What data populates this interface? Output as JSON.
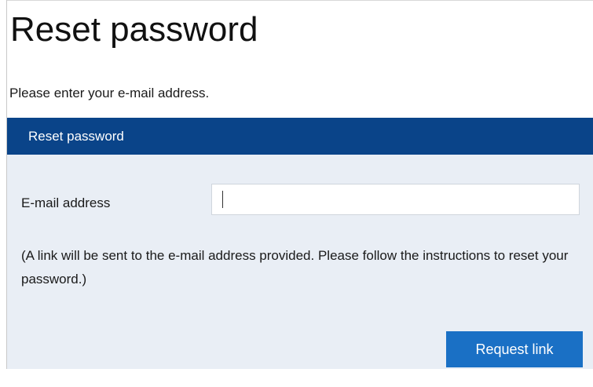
{
  "page": {
    "title": "Reset password",
    "intro": "Please enter your e-mail address."
  },
  "panel": {
    "header": "Reset password",
    "email_label": "E-mail address",
    "email_value": "",
    "help_text": "(A link will be sent to the e-mail address provided. Please follow the instructions to reset your password.)",
    "submit_label": "Request link"
  },
  "colors": {
    "header_bg": "#0a4489",
    "panel_bg": "#e9eef5",
    "button_bg": "#1a70c5"
  }
}
